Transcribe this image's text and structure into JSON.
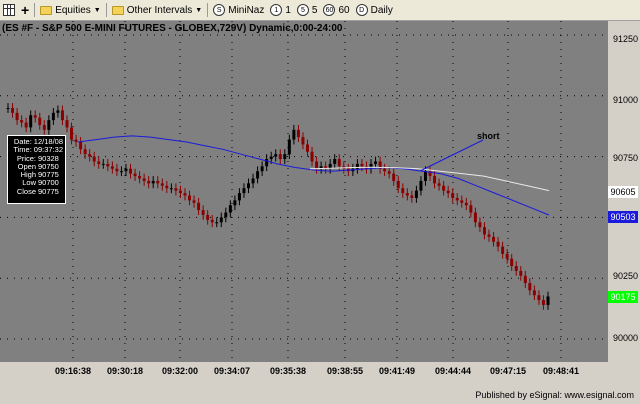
{
  "toolbar": {
    "equities_label": "Equities",
    "other_intervals_label": "Other Intervals",
    "mininaz_label": "MiniNaz",
    "interval_1": "1",
    "interval_5": "5",
    "interval_60": "60",
    "interval_daily": "Daily",
    "circle_1": "1",
    "circle_5": "5",
    "circle_60": "60",
    "circle_daily": "D",
    "circle_mininaz": "S"
  },
  "chart": {
    "title": "(ES #F - S&P 500 E-MINI FUTURES - GLOBEX,729V) Dynamic,0:00-24:00",
    "annotation": "short"
  },
  "info_box": {
    "date_key": "Date:",
    "date_val": "12/18/08",
    "time_key": "Time:",
    "time_val": "09:37:32",
    "price_key": "Price:",
    "price_val": "90328",
    "open_key": "Open",
    "open_val": "90750",
    "high_key": "High",
    "high_val": "90775",
    "low_key": "Low",
    "low_val": "90700",
    "close_key": "Close",
    "close_val": "90775"
  },
  "tags": {
    "white_ma": "90605",
    "blue_ma": "90503",
    "last_price": "90175"
  },
  "colors": {
    "background": "#808080",
    "up_bar": "#000000",
    "down_bar": "#8b0000",
    "white_ma": "#e8e8e8",
    "blue_ma": "#1a1adb",
    "last_price_tag": "#00ff00"
  },
  "chart_data": {
    "type": "candlestick",
    "title": "(ES #F - S&P 500 E-MINI FUTURES - GLOBEX,729V) Dynamic,0:00-24:00",
    "price_ticks": [
      "91250",
      "91000",
      "90750",
      "90500",
      "90250",
      "90000"
    ],
    "price_tick_values": [
      91250,
      91000,
      90750,
      90500,
      90250,
      90000
    ],
    "time_ticks": [
      "09:16:38",
      "09:30:18",
      "09:32:00",
      "09:34:07",
      "09:35:38",
      "09:38:55",
      "09:41:49",
      "09:44:44",
      "09:47:15",
      "09:48:41"
    ],
    "ylim": [
      89850,
      91350
    ],
    "grid": true,
    "series": [
      {
        "name": "",
        "values": [
          90950,
          90930,
          90900,
          90890,
          90870,
          90920,
          90910,
          90880,
          90860,
          90900,
          90930,
          90940,
          90900,
          90870,
          90820,
          90810,
          90780,
          90760,
          90750,
          90730,
          90720,
          90720,
          90710,
          90700,
          90690,
          90690,
          90700,
          90680,
          90670,
          90660,
          90650,
          90640,
          90650,
          90640,
          90630,
          90620,
          90620,
          90610,
          90600,
          90590,
          90570,
          90560,
          90530,
          90510,
          90490,
          90480,
          90480,
          90500,
          90520,
          90550,
          90570,
          90600,
          90620,
          90640,
          90660,
          90690,
          90710,
          90740,
          90750,
          90760,
          90740,
          90760,
          90820,
          90860,
          90830,
          90800,
          90770,
          90730,
          90700,
          90710,
          90700,
          90720,
          90740,
          90710,
          90700,
          90690,
          90700,
          90720,
          90710,
          90700,
          90720,
          90730,
          90700,
          90690,
          90680,
          90650,
          90620,
          90600,
          90590,
          90580,
          90610,
          90650,
          90690,
          90670,
          90640,
          90630,
          90610,
          90600,
          90580,
          90570,
          90560,
          90550,
          90520,
          90480,
          90460,
          90430,
          90420,
          90400,
          90380,
          90350,
          90330,
          90300,
          90280,
          90260,
          90230,
          90200,
          90180,
          90160,
          90140,
          90175
        ]
      }
    ],
    "moving_averages": [
      {
        "color": "blue",
        "values": [
          90810,
          90820,
          90830,
          90835,
          90830,
          90820,
          90810,
          90795,
          90780,
          90760,
          90740,
          90720,
          90705,
          90695,
          90690,
          90695,
          90700,
          90705,
          90700,
          90690,
          90680,
          90660,
          90630,
          90600,
          90570,
          90540,
          90510
        ]
      },
      {
        "color": "white",
        "values": [
          90700,
          90702,
          90705,
          90706,
          90704,
          90700,
          90690,
          90680,
          90670,
          90650,
          90630,
          90610
        ]
      }
    ],
    "last_price": 90175
  }
}
